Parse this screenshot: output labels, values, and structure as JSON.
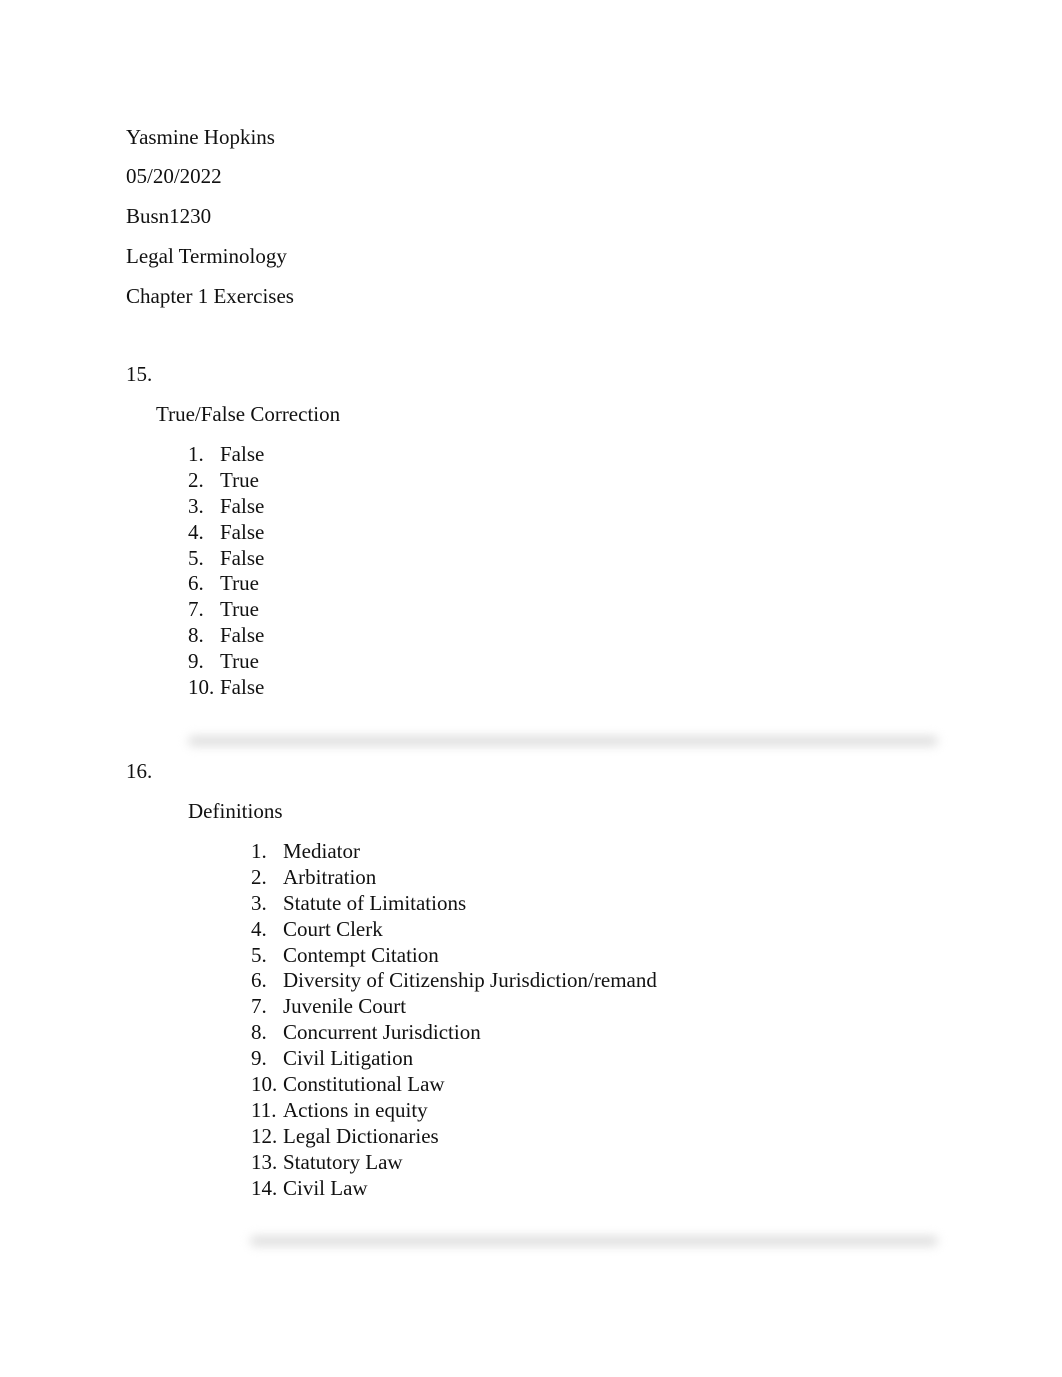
{
  "header": {
    "name": "Yasmine Hopkins",
    "date": "05/20/2022",
    "course": "Busn1230",
    "subject": "Legal Terminology",
    "assignment": "Chapter 1 Exercises"
  },
  "sections": [
    {
      "number": "15.",
      "title": "True/False Correction",
      "items": [
        {
          "n": "1.",
          "text": "False"
        },
        {
          "n": "2.",
          "text": "True"
        },
        {
          "n": "3.",
          "text": "False"
        },
        {
          "n": "4.",
          "text": "False"
        },
        {
          "n": "5.",
          "text": "False"
        },
        {
          "n": "6.",
          "text": "True"
        },
        {
          "n": "7.",
          "text": "True"
        },
        {
          "n": "8.",
          "text": "False"
        },
        {
          "n": "9.",
          "text": "True"
        },
        {
          "n": "10.",
          "text": "False"
        }
      ]
    },
    {
      "number": "16.",
      "title": "Definitions",
      "items": [
        {
          "n": "1.",
          "text": "Mediator"
        },
        {
          "n": "2.",
          "text": "Arbitration"
        },
        {
          "n": "3.",
          "text": "Statute of Limitations"
        },
        {
          "n": "4.",
          "text": "Court Clerk"
        },
        {
          "n": "5.",
          "text": "Contempt Citation"
        },
        {
          "n": "6.",
          "text": "Diversity of Citizenship Jurisdiction/remand"
        },
        {
          "n": "7.",
          "text": "Juvenile Court"
        },
        {
          "n": "8.",
          "text": "Concurrent Jurisdiction"
        },
        {
          "n": "9.",
          "text": "Civil Litigation"
        },
        {
          "n": "10.",
          "text": "Constitutional Law"
        },
        {
          "n": "11.",
          "text": "Actions in equity"
        },
        {
          "n": "12.",
          "text": "Legal Dictionaries"
        },
        {
          "n": "13.",
          "text": "Statutory Law"
        },
        {
          "n": "14.",
          "text": "Civil Law"
        }
      ]
    }
  ]
}
